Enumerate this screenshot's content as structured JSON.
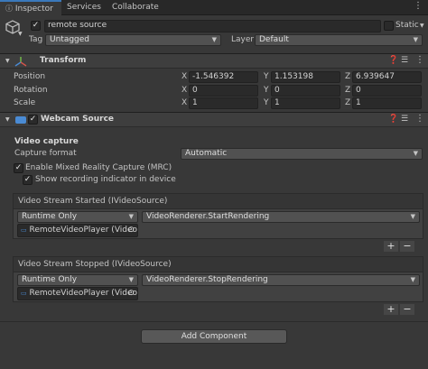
{
  "tabs": [
    {
      "label": "Inspector"
    },
    {
      "label": "Services"
    },
    {
      "label": "Collaborate"
    }
  ],
  "object": {
    "name": "remote source",
    "static_label": "Static",
    "tag_label": "Tag",
    "tag_value": "Untagged",
    "layer_label": "Layer",
    "layer_value": "Default"
  },
  "transform": {
    "title": "Transform",
    "rows": [
      {
        "label": "Position",
        "x": "-1.546392",
        "y": "1.153198",
        "z": "6.939647"
      },
      {
        "label": "Rotation",
        "x": "0",
        "y": "0",
        "z": "0"
      },
      {
        "label": "Scale",
        "x": "1",
        "y": "1",
        "z": "1"
      }
    ],
    "axis": {
      "x": "X",
      "y": "Y",
      "z": "Z"
    }
  },
  "webcam": {
    "title": "Webcam Source",
    "section_title": "Video capture",
    "capture_format_label": "Capture format",
    "capture_format_value": "Automatic",
    "mrc_label": "Enable Mixed Reality Capture (MRC)",
    "recording_label": "Show recording indicator in device"
  },
  "events": [
    {
      "title": "Video Stream Started (IVideoSource)",
      "mode": "Runtime Only",
      "method": "VideoRenderer.StartRendering",
      "target": "RemoteVideoPlayer (Video"
    },
    {
      "title": "Video Stream Stopped (IVideoSource)",
      "mode": "Runtime Only",
      "method": "VideoRenderer.StopRendering",
      "target": "RemoteVideoPlayer (Video"
    }
  ],
  "buttons": {
    "plus": "+",
    "minus": "−",
    "add_component": "Add Component"
  },
  "colors": {
    "accent": "#3a79bb",
    "background": "#383838",
    "header": "#3e3e3e"
  }
}
